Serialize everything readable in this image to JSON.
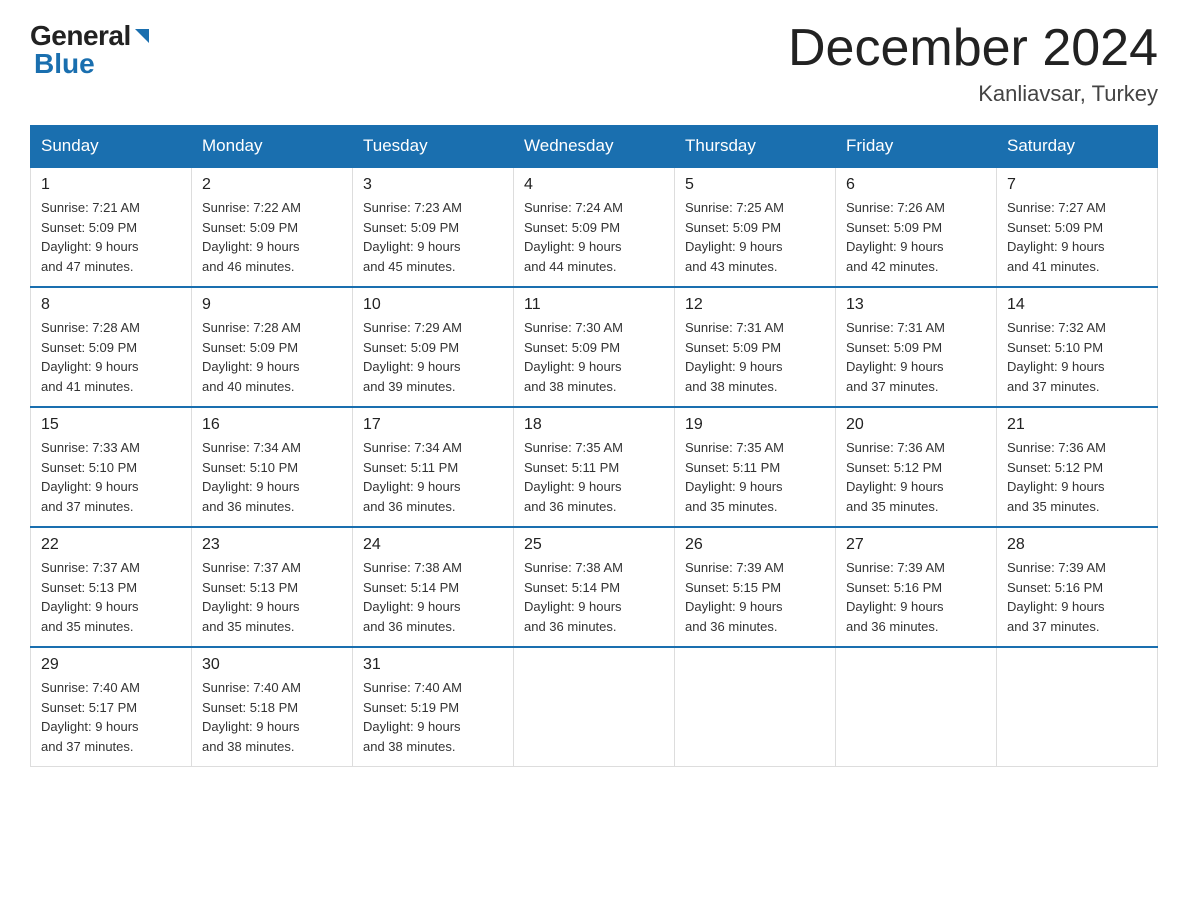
{
  "logo": {
    "general": "General",
    "blue": "Blue"
  },
  "title": {
    "month": "December 2024",
    "location": "Kanliavsar, Turkey"
  },
  "weekdays": [
    "Sunday",
    "Monday",
    "Tuesday",
    "Wednesday",
    "Thursday",
    "Friday",
    "Saturday"
  ],
  "weeks": [
    [
      {
        "day": "1",
        "sunrise": "7:21 AM",
        "sunset": "5:09 PM",
        "daylight": "9 hours and 47 minutes."
      },
      {
        "day": "2",
        "sunrise": "7:22 AM",
        "sunset": "5:09 PM",
        "daylight": "9 hours and 46 minutes."
      },
      {
        "day": "3",
        "sunrise": "7:23 AM",
        "sunset": "5:09 PM",
        "daylight": "9 hours and 45 minutes."
      },
      {
        "day": "4",
        "sunrise": "7:24 AM",
        "sunset": "5:09 PM",
        "daylight": "9 hours and 44 minutes."
      },
      {
        "day": "5",
        "sunrise": "7:25 AM",
        "sunset": "5:09 PM",
        "daylight": "9 hours and 43 minutes."
      },
      {
        "day": "6",
        "sunrise": "7:26 AM",
        "sunset": "5:09 PM",
        "daylight": "9 hours and 42 minutes."
      },
      {
        "day": "7",
        "sunrise": "7:27 AM",
        "sunset": "5:09 PM",
        "daylight": "9 hours and 41 minutes."
      }
    ],
    [
      {
        "day": "8",
        "sunrise": "7:28 AM",
        "sunset": "5:09 PM",
        "daylight": "9 hours and 41 minutes."
      },
      {
        "day": "9",
        "sunrise": "7:28 AM",
        "sunset": "5:09 PM",
        "daylight": "9 hours and 40 minutes."
      },
      {
        "day": "10",
        "sunrise": "7:29 AM",
        "sunset": "5:09 PM",
        "daylight": "9 hours and 39 minutes."
      },
      {
        "day": "11",
        "sunrise": "7:30 AM",
        "sunset": "5:09 PM",
        "daylight": "9 hours and 38 minutes."
      },
      {
        "day": "12",
        "sunrise": "7:31 AM",
        "sunset": "5:09 PM",
        "daylight": "9 hours and 38 minutes."
      },
      {
        "day": "13",
        "sunrise": "7:31 AM",
        "sunset": "5:09 PM",
        "daylight": "9 hours and 37 minutes."
      },
      {
        "day": "14",
        "sunrise": "7:32 AM",
        "sunset": "5:10 PM",
        "daylight": "9 hours and 37 minutes."
      }
    ],
    [
      {
        "day": "15",
        "sunrise": "7:33 AM",
        "sunset": "5:10 PM",
        "daylight": "9 hours and 37 minutes."
      },
      {
        "day": "16",
        "sunrise": "7:34 AM",
        "sunset": "5:10 PM",
        "daylight": "9 hours and 36 minutes."
      },
      {
        "day": "17",
        "sunrise": "7:34 AM",
        "sunset": "5:11 PM",
        "daylight": "9 hours and 36 minutes."
      },
      {
        "day": "18",
        "sunrise": "7:35 AM",
        "sunset": "5:11 PM",
        "daylight": "9 hours and 36 minutes."
      },
      {
        "day": "19",
        "sunrise": "7:35 AM",
        "sunset": "5:11 PM",
        "daylight": "9 hours and 35 minutes."
      },
      {
        "day": "20",
        "sunrise": "7:36 AM",
        "sunset": "5:12 PM",
        "daylight": "9 hours and 35 minutes."
      },
      {
        "day": "21",
        "sunrise": "7:36 AM",
        "sunset": "5:12 PM",
        "daylight": "9 hours and 35 minutes."
      }
    ],
    [
      {
        "day": "22",
        "sunrise": "7:37 AM",
        "sunset": "5:13 PM",
        "daylight": "9 hours and 35 minutes."
      },
      {
        "day": "23",
        "sunrise": "7:37 AM",
        "sunset": "5:13 PM",
        "daylight": "9 hours and 35 minutes."
      },
      {
        "day": "24",
        "sunrise": "7:38 AM",
        "sunset": "5:14 PM",
        "daylight": "9 hours and 36 minutes."
      },
      {
        "day": "25",
        "sunrise": "7:38 AM",
        "sunset": "5:14 PM",
        "daylight": "9 hours and 36 minutes."
      },
      {
        "day": "26",
        "sunrise": "7:39 AM",
        "sunset": "5:15 PM",
        "daylight": "9 hours and 36 minutes."
      },
      {
        "day": "27",
        "sunrise": "7:39 AM",
        "sunset": "5:16 PM",
        "daylight": "9 hours and 36 minutes."
      },
      {
        "day": "28",
        "sunrise": "7:39 AM",
        "sunset": "5:16 PM",
        "daylight": "9 hours and 37 minutes."
      }
    ],
    [
      {
        "day": "29",
        "sunrise": "7:40 AM",
        "sunset": "5:17 PM",
        "daylight": "9 hours and 37 minutes."
      },
      {
        "day": "30",
        "sunrise": "7:40 AM",
        "sunset": "5:18 PM",
        "daylight": "9 hours and 38 minutes."
      },
      {
        "day": "31",
        "sunrise": "7:40 AM",
        "sunset": "5:19 PM",
        "daylight": "9 hours and 38 minutes."
      },
      null,
      null,
      null,
      null
    ]
  ],
  "labels": {
    "sunrise": "Sunrise:",
    "sunset": "Sunset:",
    "daylight": "Daylight:"
  }
}
